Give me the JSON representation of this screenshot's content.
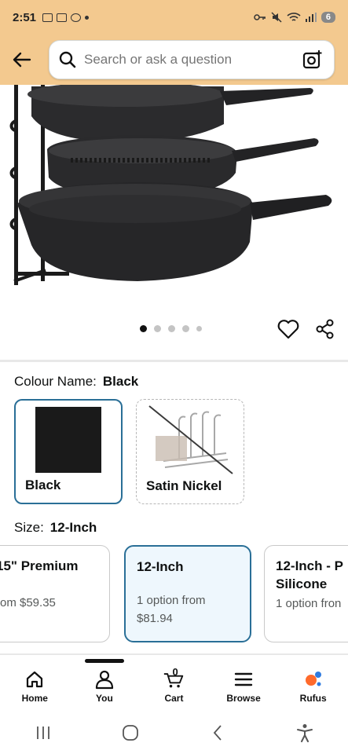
{
  "status": {
    "time": "2:51",
    "battery": "6"
  },
  "search": {
    "placeholder": "Search or ask a question"
  },
  "carousel": {
    "dot_count": 5,
    "active_index": 0
  },
  "variation": {
    "colour_label": "Colour Name:",
    "colour_selected": "Black",
    "colours": [
      {
        "name": "Black",
        "swatch": "#1a1a1a",
        "selected": true,
        "available": true
      },
      {
        "name": "Satin Nickel",
        "selected": false,
        "available": false
      }
    ],
    "size_label": "Size:",
    "size_selected": "12-Inch",
    "sizes": [
      {
        "title": "15\" Premium",
        "sub": "rom $59.35"
      },
      {
        "title": "12-Inch",
        "sub": "1 option from\n$81.94",
        "selected": true
      },
      {
        "title": "12-Inch - P\nSilicone",
        "sub": "1 option fron"
      }
    ]
  },
  "bottom_nav": [
    {
      "label": "Home",
      "icon": "home-icon"
    },
    {
      "label": "You",
      "icon": "user-icon"
    },
    {
      "label": "Cart",
      "icon": "cart-icon",
      "badge": "0"
    },
    {
      "label": "Browse",
      "icon": "menu-icon"
    },
    {
      "label": "Rufus",
      "icon": "rufus-icon"
    }
  ],
  "colors": {
    "header_bg": "#f3c98f",
    "selected_border": "#2a6f97",
    "selected_bg": "#eef7fd"
  }
}
